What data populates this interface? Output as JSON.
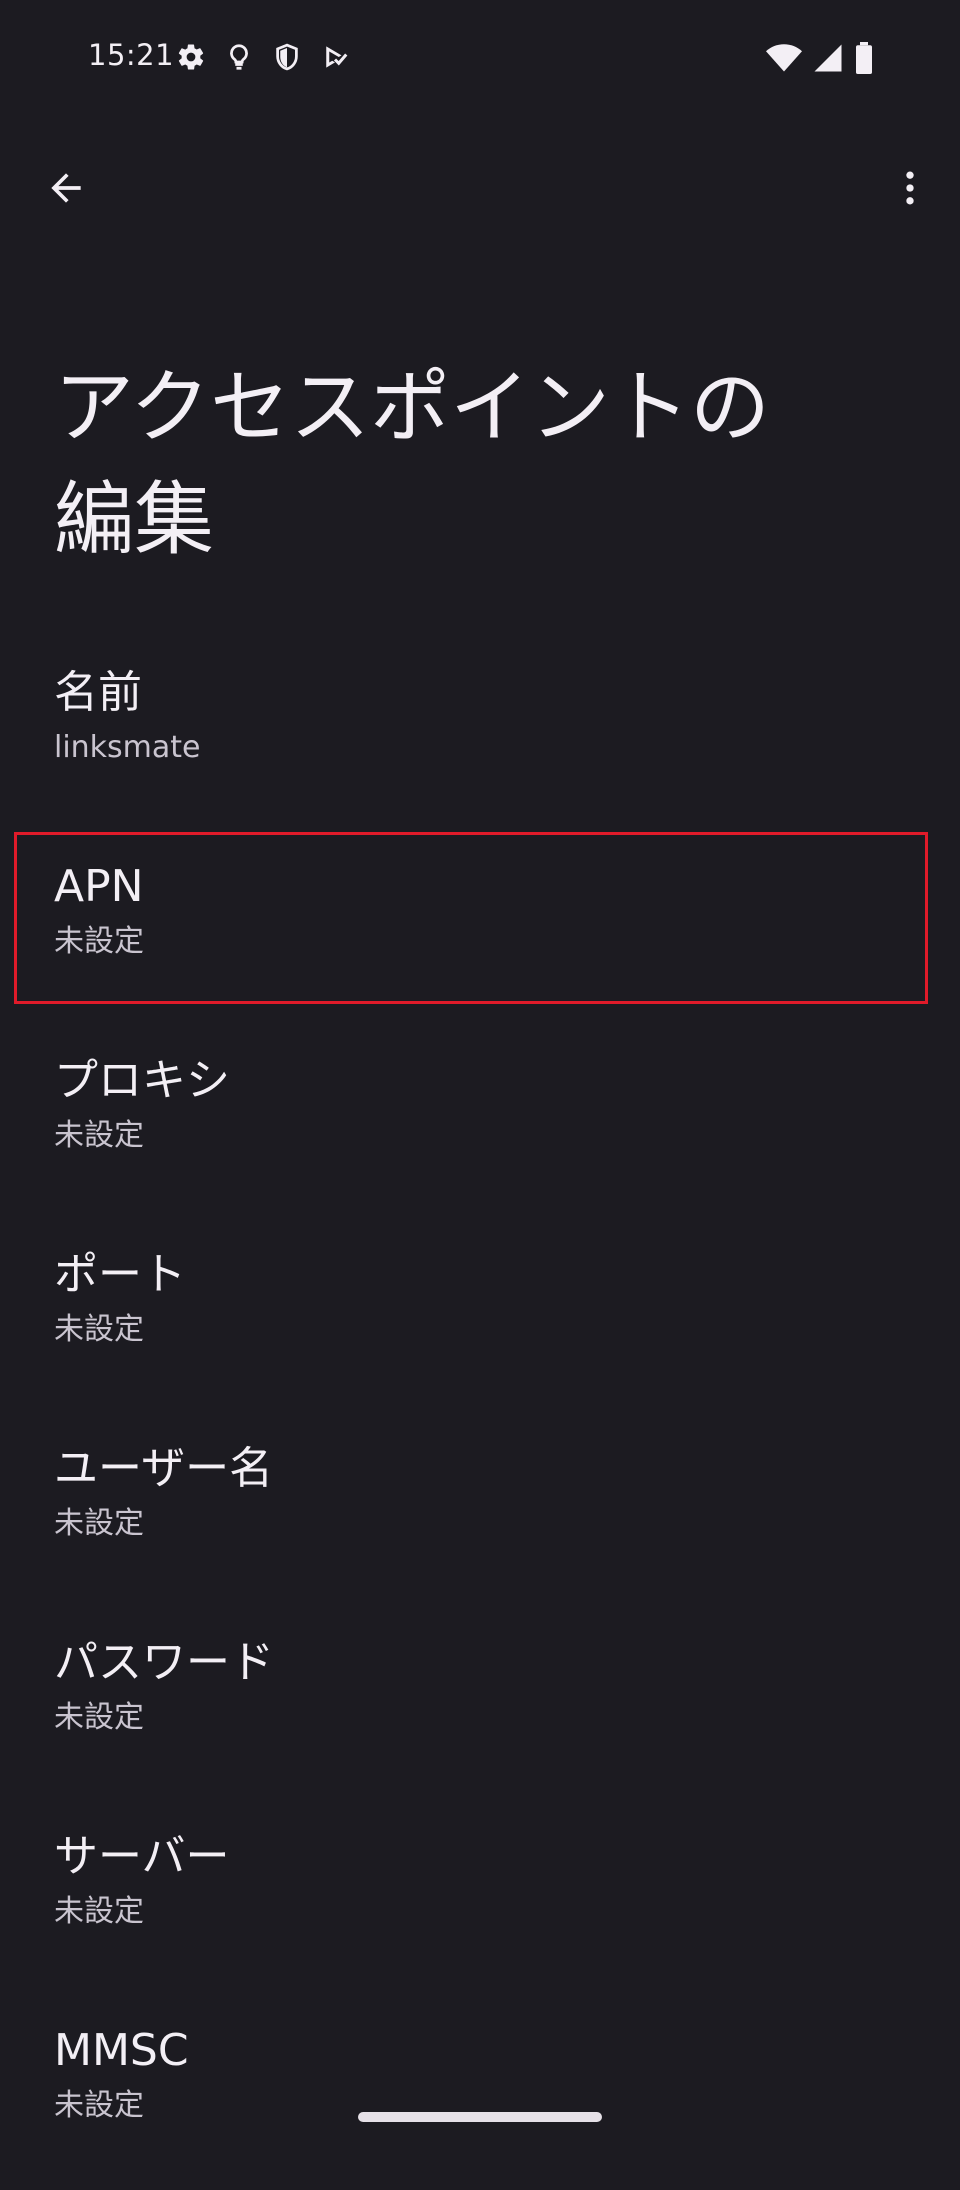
{
  "status_bar": {
    "time": "15:21",
    "left_icons": [
      "settings-icon",
      "lightbulb-icon",
      "shield-icon",
      "play-check-icon"
    ],
    "right_icons": [
      "wifi-icon",
      "cell-signal-icon",
      "battery-icon"
    ]
  },
  "app_bar": {
    "back_icon": "arrow-back-icon",
    "more_icon": "more-vert-icon"
  },
  "page": {
    "title_line1": "アクセスポイントの",
    "title_line2": "編集"
  },
  "settings": {
    "items": [
      {
        "title": "名前",
        "summary": "linksmate"
      },
      {
        "title": "APN",
        "summary": "未設定",
        "highlighted": true
      },
      {
        "title": "プロキシ",
        "summary": "未設定"
      },
      {
        "title": "ポート",
        "summary": "未設定"
      },
      {
        "title": "ユーザー名",
        "summary": "未設定"
      },
      {
        "title": "パスワード",
        "summary": "未設定"
      },
      {
        "title": "サーバー",
        "summary": "未設定"
      },
      {
        "title": "MMSC",
        "summary": "未設定"
      }
    ]
  },
  "colors": {
    "background": "#1c1b21",
    "text_primary": "#f3eff5",
    "text_secondary": "#c9c4cf",
    "highlight_border": "#e01b2a"
  }
}
